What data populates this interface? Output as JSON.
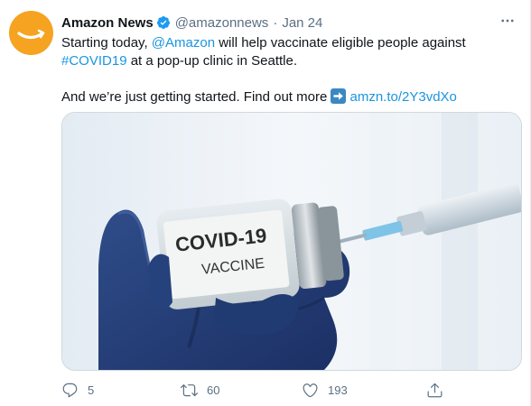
{
  "tweet": {
    "author_name": "Amazon News",
    "handle": "@amazonnews",
    "separator": "·",
    "date": "Jan 24",
    "text": {
      "line1_pre": "Starting today, ",
      "mention": "@Amazon",
      "line1_post": " will help vaccinate eligible people against",
      "hashtag": "#COVID19",
      "line2_post": " at a pop-up clinic in Seattle.",
      "line3_pre": "And we’re just getting started. Find out more ",
      "url": "amzn.to/2Y3vdXo"
    },
    "media": {
      "vial_label_line1": "COVID-19",
      "vial_label_line2": "VACCINE"
    },
    "actions": {
      "replies": "5",
      "retweets": "60",
      "likes": "193"
    }
  },
  "colors": {
    "link": "#1b95e0",
    "avatar": "#f5a320",
    "muted": "#5b7083"
  },
  "icons": [
    "verified-badge-icon",
    "more-options-icon",
    "right-arrow-emoji-icon",
    "reply-icon",
    "retweet-icon",
    "like-icon",
    "share-icon"
  ]
}
